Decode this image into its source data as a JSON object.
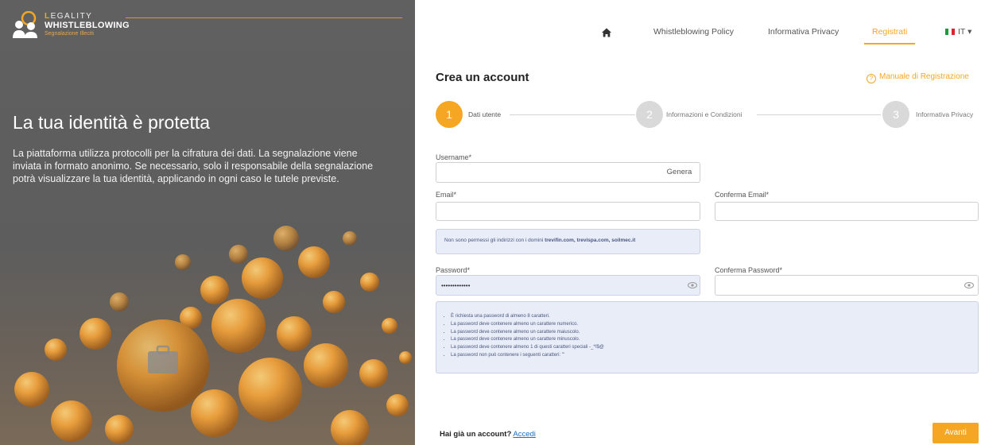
{
  "brand": {
    "line1_first": "L",
    "line1_rest": "EGALITY",
    "line2": "WHISTLEBLOWING",
    "line3": "Segnalazione Illeciti"
  },
  "hero": {
    "title": "La tua identità è protetta",
    "text": "La piattaforma utilizza protocolli per la cifratura dei dati. La segnalazione viene inviata in formato anonimo. Se necessario, solo il responsabile della segnalazione potrà visualizzare la tua identità, applicando in ogni caso le tutele previste."
  },
  "nav": {
    "home_icon": "home-icon",
    "items": [
      "Whistleblowing Policy",
      "Informativa Privacy",
      "Registrati"
    ],
    "language": "IT"
  },
  "page": {
    "title": "Crea un account",
    "manual_link": "Manuale di Registrazione",
    "manual_icon_glyph": "?"
  },
  "stepper": [
    {
      "number": "1",
      "label": "Dati utente",
      "active": true
    },
    {
      "number": "2",
      "label": "Informazioni e Condizioni",
      "active": false
    },
    {
      "number": "3",
      "label": "Informativa Privacy",
      "active": false
    }
  ],
  "colors": {
    "accent": "#f5a623",
    "inactive_step": "#d9d9d9",
    "info_bg": "#e8edf7",
    "link": "#1e6fc0"
  },
  "form": {
    "username_label": "Username*",
    "username_value": "",
    "generate_button": "Genera",
    "email_label": "Email*",
    "email_value": "",
    "email_confirm_label": "Conferma Email*",
    "email_confirm_value": "",
    "email_note_prefix": "Non sono permessi gli indirizzi con i domini ",
    "email_note_domains": "trevifin.com, trevispa.com, soilmec.it",
    "password_label": "Password*",
    "password_value": "•••••••••••••",
    "password_confirm_label": "Conferma Password*",
    "password_confirm_value": "",
    "password_rules": [
      "È richiesta una password di almeno 8 caratteri.",
      "La password deve contenere almeno un carattere numerico.",
      "La password deve contenere almeno un carattere maiuscolo.",
      "La password deve contenere almeno un carattere minuscolo.",
      "La password deve contenere almeno 1 di questi caratteri speciali -_*!$@",
      "La password non può contenere i seguenti caratteri: '\""
    ]
  },
  "footer": {
    "question": "Hai già un account?",
    "login_link": "Accedi",
    "next_button": "Avanti"
  }
}
